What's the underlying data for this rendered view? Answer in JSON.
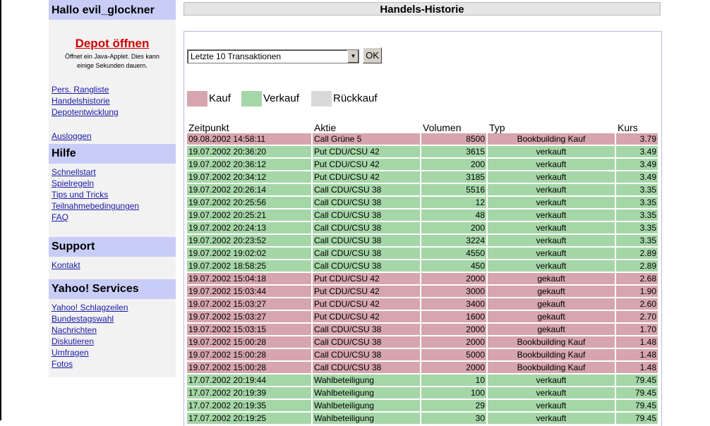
{
  "sidebar": {
    "greeting": "Hallo evil_glockner",
    "depot_link": "Depot öffnen",
    "depot_note_line1": "Öffnet ein Java-Applet. Dies kann",
    "depot_note_line2": "einige Sekunden dauern.",
    "main_links": [
      "Pers. Rangliste",
      "Handelshistorie",
      "Depotentwicklung"
    ],
    "logout": "Ausloggen",
    "hilfe_title": "Hilfe",
    "hilfe_links": [
      "Schnellstart",
      "Spielregeln",
      "Tips und Tricks",
      "Teilnahmebedingungen",
      "FAQ"
    ],
    "support_title": "Support",
    "support_links": [
      "Kontakt"
    ],
    "yahoo_title": "Yahoo! Services",
    "yahoo_links": [
      "Yahoo! Schlagzeilen",
      "Bundestagswahl",
      "Nachrichten",
      "Diskutieren",
      "Umfragen",
      "Fotos"
    ]
  },
  "main": {
    "title": "Handels-Historie",
    "filter_select": "Letzte 10 Transaktionen",
    "ok_button": "OK",
    "legend": [
      {
        "label": "Kauf",
        "color": "#d6a5ad"
      },
      {
        "label": "Verkauf",
        "color": "#a5d6a7"
      },
      {
        "label": "Rückkauf",
        "color": "#d9d9d9"
      }
    ],
    "columns": [
      "Zeitpunkt",
      "Aktie",
      "Volumen",
      "Typ",
      "Kurs"
    ],
    "colors": {
      "kauf": "#d6a5ad",
      "verkauf": "#a5d6a7"
    },
    "rows": [
      {
        "time": "09.08.2002 14:58:11",
        "aktie": "Call Grüne 5",
        "volumen": "8500",
        "typ": "Bookbuilding Kauf",
        "kurs": "3.79",
        "kind": "kauf"
      },
      {
        "time": "19.07.2002 20:36:20",
        "aktie": "Put CDU/CSU 42",
        "volumen": "3615",
        "typ": "verkauft",
        "kurs": "3.49",
        "kind": "verkauf"
      },
      {
        "time": "19.07.2002 20:36:12",
        "aktie": "Put CDU/CSU 42",
        "volumen": "200",
        "typ": "verkauft",
        "kurs": "3.49",
        "kind": "verkauf"
      },
      {
        "time": "19.07.2002 20:34:12",
        "aktie": "Put CDU/CSU 42",
        "volumen": "3185",
        "typ": "verkauft",
        "kurs": "3.49",
        "kind": "verkauf"
      },
      {
        "time": "19.07.2002 20:26:14",
        "aktie": "Call CDU/CSU 38",
        "volumen": "5516",
        "typ": "verkauft",
        "kurs": "3.35",
        "kind": "verkauf"
      },
      {
        "time": "19.07.2002 20:25:56",
        "aktie": "Call CDU/CSU 38",
        "volumen": "12",
        "typ": "verkauft",
        "kurs": "3.35",
        "kind": "verkauf"
      },
      {
        "time": "19.07.2002 20:25:21",
        "aktie": "Call CDU/CSU 38",
        "volumen": "48",
        "typ": "verkauft",
        "kurs": "3.35",
        "kind": "verkauf"
      },
      {
        "time": "19.07.2002 20:24:13",
        "aktie": "Call CDU/CSU 38",
        "volumen": "200",
        "typ": "verkauft",
        "kurs": "3.35",
        "kind": "verkauf"
      },
      {
        "time": "19.07.2002 20:23:52",
        "aktie": "Call CDU/CSU 38",
        "volumen": "3224",
        "typ": "verkauft",
        "kurs": "3.35",
        "kind": "verkauf"
      },
      {
        "time": "19.07.2002 19:02:02",
        "aktie": "Call CDU/CSU 38",
        "volumen": "4550",
        "typ": "verkauft",
        "kurs": "2.89",
        "kind": "verkauf"
      },
      {
        "time": "19.07.2002 18:58:25",
        "aktie": "Call CDU/CSU 38",
        "volumen": "450",
        "typ": "verkauft",
        "kurs": "2.89",
        "kind": "verkauf"
      },
      {
        "time": "19.07.2002 15:04:18",
        "aktie": "Put CDU/CSU 42",
        "volumen": "2000",
        "typ": "gekauft",
        "kurs": "2.68",
        "kind": "kauf"
      },
      {
        "time": "19.07.2002 15:03:44",
        "aktie": "Put CDU/CSU 42",
        "volumen": "3000",
        "typ": "gekauft",
        "kurs": "1.90",
        "kind": "kauf"
      },
      {
        "time": "19.07.2002 15:03:27",
        "aktie": "Put CDU/CSU 42",
        "volumen": "3400",
        "typ": "gekauft",
        "kurs": "2.60",
        "kind": "kauf"
      },
      {
        "time": "19.07.2002 15:03:27",
        "aktie": "Put CDU/CSU 42",
        "volumen": "1600",
        "typ": "gekauft",
        "kurs": "2.70",
        "kind": "kauf"
      },
      {
        "time": "19.07.2002 15:03:15",
        "aktie": "Call CDU/CSU 38",
        "volumen": "2000",
        "typ": "gekauft",
        "kurs": "1.70",
        "kind": "kauf"
      },
      {
        "time": "19.07.2002 15:00:28",
        "aktie": "Call CDU/CSU 38",
        "volumen": "2000",
        "typ": "Bookbuilding Kauf",
        "kurs": "1.48",
        "kind": "kauf"
      },
      {
        "time": "19.07.2002 15:00:28",
        "aktie": "Call CDU/CSU 38",
        "volumen": "5000",
        "typ": "Bookbuilding Kauf",
        "kurs": "1.48",
        "kind": "kauf"
      },
      {
        "time": "19.07.2002 15:00:28",
        "aktie": "Call CDU/CSU 38",
        "volumen": "2000",
        "typ": "Bookbuilding Kauf",
        "kurs": "1.48",
        "kind": "kauf"
      },
      {
        "time": "17.07.2002 20:19:44",
        "aktie": "Wahlbeteiligung",
        "volumen": "10",
        "typ": "verkauft",
        "kurs": "79.45",
        "kind": "verkauf"
      },
      {
        "time": "17.07.2002 20:19:39",
        "aktie": "Wahlbeteiligung",
        "volumen": "100",
        "typ": "verkauft",
        "kurs": "79.45",
        "kind": "verkauf"
      },
      {
        "time": "17.07.2002 20:19:35",
        "aktie": "Wahlbeteiligung",
        "volumen": "29",
        "typ": "verkauft",
        "kurs": "79.45",
        "kind": "verkauf"
      },
      {
        "time": "17.07.2002 20:19:25",
        "aktie": "Wahlbeteiligung",
        "volumen": "30",
        "typ": "verkauft",
        "kurs": "79.45",
        "kind": "verkauf"
      }
    ]
  }
}
